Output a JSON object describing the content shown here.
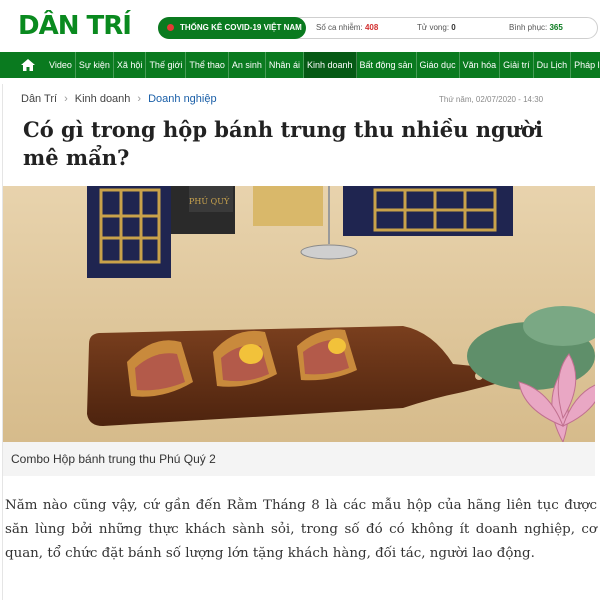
{
  "header": {
    "logo": "DÂN TRÍ",
    "covid": {
      "label": "THỐNG KÊ COVID-19 VIỆT NAM",
      "cases_label": "Số ca nhiễm:",
      "cases": "408",
      "deaths_label": "Tử vong:",
      "deaths": "0",
      "recovered_label": "Bình phục:",
      "recovered": "365"
    }
  },
  "nav": {
    "items": [
      "Video",
      "Sự kiện",
      "Xã hội",
      "Thế giới",
      "Thể thao",
      "An sinh",
      "Nhân ái",
      "Kinh doanh",
      "Bất động sản",
      "Giáo dục",
      "Văn hóa",
      "Giải trí",
      "Du Lịch",
      "Pháp luật"
    ],
    "active": "Kinh doanh"
  },
  "article": {
    "breadcrumb": [
      "Dân Trí",
      "Kinh doanh",
      "Doanh nghiệp"
    ],
    "date": "Thứ năm, 02/07/2020 - 14:30",
    "title": "Có gì trong hộp bánh trung thu nhiều người mê mẩn?",
    "image_caption": "Combo Hộp bánh trung thu Phú Quý 2",
    "image_text": "PHÚ QUÝ",
    "body": "Năm nào cũng vậy, cứ gần đến Rằm Tháng 8 là các mẫu hộp của hãng liên tục được săn lùng bởi những thực khách sành sỏi, trong số đó có không ít doanh nghiệp, cơ quan, tổ chức đặt bánh số lượng lớn tặng khách hàng, đối tác, người lao động."
  },
  "colors": {
    "brand_green": "#0a8a1f",
    "nav_green": "#0a7a1f",
    "link_blue": "#1a5fa8",
    "cases_red": "#d32f2f"
  }
}
